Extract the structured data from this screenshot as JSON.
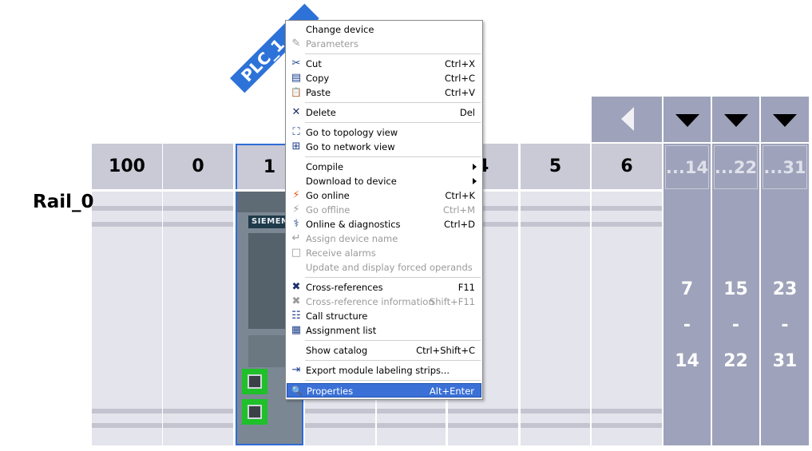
{
  "rack": {
    "rail_label": "Rail_0",
    "plc_tag": "PLC_1",
    "slot_headers": [
      "100",
      "0",
      "1",
      "",
      "4",
      "5",
      "6"
    ],
    "plc_brand": "SIEMENS",
    "groups": [
      {
        "header": "...14",
        "from": "7",
        "dash": "-",
        "to": "14"
      },
      {
        "header": "...22",
        "from": "15",
        "dash": "-",
        "to": "22"
      },
      {
        "header": "...31",
        "from": "23",
        "dash": "-",
        "to": "31"
      }
    ]
  },
  "menu": {
    "items": [
      {
        "label": "Change device",
        "shortcut": "",
        "icon": "change-device-icon",
        "glyph": "",
        "disabled": false
      },
      {
        "label": "Parameters",
        "shortcut": "",
        "icon": "parameters-icon",
        "glyph": "✎",
        "disabled": true
      },
      {
        "label": "Cut",
        "shortcut": "Ctrl+X",
        "icon": "scissors-icon",
        "glyph": "✂",
        "disabled": false
      },
      {
        "label": "Copy",
        "shortcut": "Ctrl+C",
        "icon": "copy-icon",
        "glyph": "▤",
        "disabled": false
      },
      {
        "label": "Paste",
        "shortcut": "Ctrl+V",
        "icon": "paste-icon",
        "glyph": "📋",
        "disabled": false
      },
      {
        "label": "Delete",
        "shortcut": "Del",
        "icon": "delete-icon",
        "glyph": "✕",
        "disabled": false
      },
      {
        "label": "Go to topology view",
        "shortcut": "",
        "icon": "topology-view-icon",
        "glyph": "⛶",
        "disabled": false
      },
      {
        "label": "Go to network view",
        "shortcut": "",
        "icon": "network-view-icon",
        "glyph": "⊞",
        "disabled": false
      },
      {
        "label": "Compile",
        "shortcut": "",
        "icon": "",
        "glyph": "",
        "disabled": false,
        "submenu": true
      },
      {
        "label": "Download to device",
        "shortcut": "",
        "icon": "",
        "glyph": "",
        "disabled": false,
        "submenu": true
      },
      {
        "label": "Go online",
        "shortcut": "Ctrl+K",
        "icon": "go-online-icon",
        "glyph": "⚡",
        "disabled": false
      },
      {
        "label": "Go offline",
        "shortcut": "Ctrl+M",
        "icon": "go-offline-icon",
        "glyph": "⚡",
        "disabled": true
      },
      {
        "label": "Online & diagnostics",
        "shortcut": "Ctrl+D",
        "icon": "diagnostics-icon",
        "glyph": "⚕",
        "disabled": false
      },
      {
        "label": "Assign device name",
        "shortcut": "",
        "icon": "assign-name-icon",
        "glyph": "↵",
        "disabled": true
      },
      {
        "label": "Receive alarms",
        "shortcut": "",
        "icon": "alarms-icon",
        "glyph": "□",
        "disabled": true
      },
      {
        "label": "Update and display forced operands",
        "shortcut": "",
        "icon": "",
        "glyph": "",
        "disabled": true
      },
      {
        "label": "Cross-references",
        "shortcut": "F11",
        "icon": "cross-references-icon",
        "glyph": "✖",
        "disabled": false
      },
      {
        "label": "Cross-reference information",
        "shortcut": "Shift+F11",
        "icon": "cross-reference-info-icon",
        "glyph": "✖",
        "disabled": true
      },
      {
        "label": "Call structure",
        "shortcut": "",
        "icon": "call-structure-icon",
        "glyph": "☷",
        "disabled": false
      },
      {
        "label": "Assignment list",
        "shortcut": "",
        "icon": "assignment-list-icon",
        "glyph": "▦",
        "disabled": false
      },
      {
        "label": "Show catalog",
        "shortcut": "Ctrl+Shift+C",
        "icon": "",
        "glyph": "",
        "disabled": false
      },
      {
        "label": "Export module labeling strips...",
        "shortcut": "",
        "icon": "export-icon",
        "glyph": "⇥",
        "disabled": false
      },
      {
        "label": "Properties",
        "shortcut": "Alt+Enter",
        "icon": "properties-icon",
        "glyph": "🔍",
        "disabled": false,
        "selected": true
      }
    ]
  }
}
